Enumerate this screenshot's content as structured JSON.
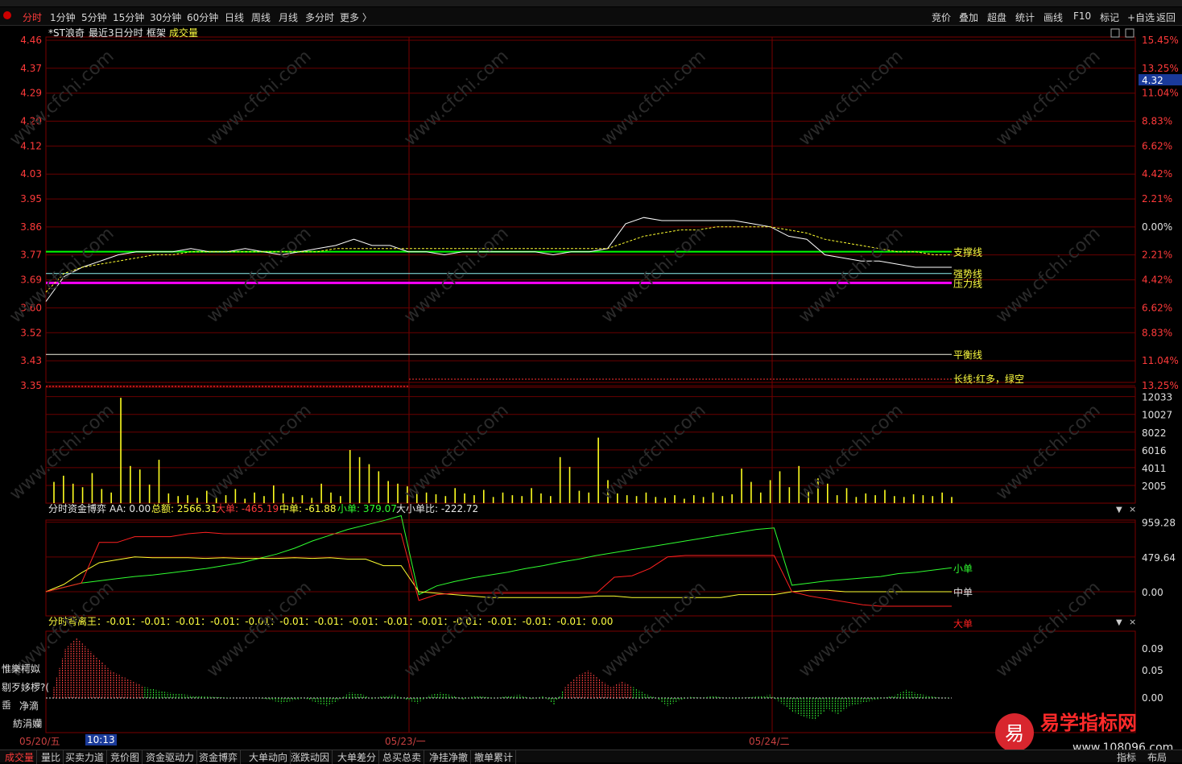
{
  "toolbar": {
    "left": [
      "分时",
      "1分钟",
      "5分钟",
      "15分钟",
      "30分钟",
      "60分钟",
      "日线",
      "周线",
      "月线",
      "多分时",
      "更多 〉"
    ],
    "right": [
      "竞价",
      "叠加",
      "超盘",
      "统计",
      "画线",
      "F10",
      "标记",
      "+自选",
      "返回"
    ]
  },
  "header": {
    "stock": "*ST浪奇",
    "mode": "最近3日分时",
    "frame": "框架",
    "indicator": "成交量"
  },
  "price_panel": {
    "left_ticks": [
      "4.46",
      "4.37",
      "4.29",
      "4.20",
      "4.12",
      "4.03",
      "3.95",
      "3.86",
      "3.77",
      "3.69",
      "3.60",
      "3.52",
      "3.43",
      "3.35"
    ],
    "right_ticks": [
      "15.45%",
      "13.25%",
      "11.04%",
      "8.83%",
      "6.62%",
      "4.42%",
      "2.21%",
      "0.00%",
      "2.21%",
      "4.42%",
      "6.62%",
      "8.83%",
      "11.04%",
      "13.25%"
    ],
    "current_price": "4.32",
    "line_labels": {
      "support": "支撑线",
      "strong": "强势线",
      "pressure": "压力线",
      "balance": "平衡线",
      "long": "长线:红多，绿空"
    }
  },
  "volume_panel": {
    "right_ticks": [
      "12033",
      "10027",
      "8022",
      "6016",
      "4011",
      "2005"
    ]
  },
  "fund_panel": {
    "title": "分时资金博弈",
    "aa": "AA: 0.00",
    "total": "总额: 2566.31",
    "large": "大单: -465.19",
    "mid": "中单: -61.88",
    "small": "小单: 379.07",
    "ratio": "大小单比: -222.72",
    "right_ticks": [
      "959.28",
      "479.64",
      "0.00"
    ],
    "line_labels": {
      "small": "小单",
      "mid": "中单",
      "large": "大单"
    }
  },
  "divergence_panel": {
    "title": "分时背离王：-0.01：-0.01：-0.01：-0.01：-0.01：-0.01：-0.01：-0.01：-0.01：-0.01：-0.01：-0.01：-0.01：-0.01：0.00",
    "right_ticks": [
      "0.09",
      "0.05",
      "0.00"
    ]
  },
  "side_labels": [
    "惟樂樗姒",
    "剔歹姼椤?(",
    "𡸁",
    "净滴",
    "紡涓孏"
  ],
  "dates": [
    "05/20/五",
    "10:13",
    "05/23/一",
    "05/24/二"
  ],
  "bottom_tabs": [
    "成交量",
    "量比",
    "买卖力道",
    "竞价图",
    "资金驱动力",
    "资金博弈",
    "大单动向",
    "涨跌动因",
    "大单差分",
    "总买总卖",
    "净挂净撤",
    "撤单累计"
  ],
  "bottom_right": [
    "指标",
    "布局"
  ],
  "brand": {
    "text": "易学指标网",
    "url": "www.108096.com"
  },
  "watermark": "www.cfchi.com",
  "colors": {
    "up": "#ff3232",
    "down": "#00e000",
    "grid": "#6a0000",
    "yellow": "#ffff00",
    "magenta": "#ff00ff",
    "cyan": "#8ef0f0",
    "green_line": "#00ff00"
  },
  "chart_data": {
    "type": "line",
    "title": "",
    "x_days": [
      "05/20/五",
      "05/23/一",
      "05/24/二"
    ],
    "price": {
      "ylim": [
        3.35,
        4.46
      ],
      "base": 3.86,
      "support": 3.77,
      "strong": 3.7,
      "pressure": 3.67,
      "balance": 3.44,
      "series": [
        {
          "name": "price",
          "values": [
            3.61,
            3.69,
            3.72,
            3.74,
            3.76,
            3.77,
            3.77,
            3.77,
            3.78,
            3.77,
            3.77,
            3.78,
            3.77,
            3.76,
            3.77,
            3.78,
            3.79,
            3.81,
            3.79,
            3.79,
            3.77,
            3.77,
            3.76,
            3.77,
            3.77,
            3.77,
            3.77,
            3.77,
            3.76,
            3.77,
            3.77,
            3.78,
            3.86,
            3.88,
            3.87,
            3.87,
            3.87,
            3.87,
            3.87,
            3.86,
            3.85,
            3.82,
            3.81,
            3.76,
            3.75,
            3.74,
            3.74,
            3.73,
            3.72,
            3.72,
            3.72
          ]
        },
        {
          "name": "avg",
          "values": [
            3.64,
            3.7,
            3.72,
            3.73,
            3.74,
            3.75,
            3.76,
            3.76,
            3.77,
            3.77,
            3.77,
            3.77,
            3.77,
            3.77,
            3.77,
            3.77,
            3.78,
            3.78,
            3.78,
            3.78,
            3.78,
            3.78,
            3.78,
            3.78,
            3.78,
            3.78,
            3.78,
            3.78,
            3.78,
            3.78,
            3.78,
            3.78,
            3.8,
            3.82,
            3.83,
            3.84,
            3.84,
            3.85,
            3.85,
            3.85,
            3.85,
            3.84,
            3.83,
            3.81,
            3.8,
            3.79,
            3.78,
            3.77,
            3.77,
            3.76,
            3.76
          ]
        }
      ]
    },
    "volume": {
      "ylim": [
        0,
        14000
      ],
      "values": [
        2400,
        3100,
        2200,
        1800,
        3400,
        1600,
        1200,
        11900,
        4200,
        3800,
        2100,
        4900,
        1100,
        800,
        900,
        600,
        1400,
        700,
        900,
        1600,
        500,
        1200,
        800,
        2000,
        1100,
        700,
        900,
        600,
        2200,
        1200,
        800,
        6000,
        5200,
        4400,
        3600,
        2500,
        2200,
        1900,
        1400,
        1200,
        1000,
        800,
        1700,
        1100,
        900,
        1500,
        700,
        1200,
        900,
        800,
        1700,
        1100,
        800,
        5200,
        4100,
        1400,
        1200,
        7400,
        2600,
        1100,
        900,
        800,
        1200,
        700,
        600,
        900,
        500,
        900,
        700,
        1200,
        800,
        1000,
        3900,
        2400,
        1200,
        2600,
        3600,
        1800,
        4200,
        1300,
        2800,
        2200,
        900,
        1700,
        700,
        1100,
        900,
        1500,
        800,
        700,
        1000,
        900,
        800,
        1200,
        700
      ]
    },
    "fund": {
      "ylim": [
        -200,
        1100
      ],
      "series": [
        {
          "name": "小单",
          "values": [
            0,
            60,
            120,
            150,
            180,
            210,
            230,
            260,
            290,
            320,
            360,
            400,
            460,
            520,
            600,
            700,
            780,
            860,
            920,
            980,
            1050,
            -40,
            80,
            140,
            190,
            230,
            270,
            320,
            360,
            410,
            450,
            500,
            540,
            580,
            620,
            660,
            700,
            740,
            780,
            820,
            860,
            880,
            90,
            120,
            150,
            170,
            190,
            210,
            250,
            270,
            300,
            330
          ]
        },
        {
          "name": "中单",
          "values": [
            0,
            100,
            260,
            400,
            440,
            480,
            470,
            470,
            470,
            460,
            470,
            460,
            460,
            460,
            470,
            460,
            470,
            450,
            450,
            360,
            360,
            0,
            -20,
            -40,
            -60,
            -80,
            -80,
            -80,
            -80,
            -80,
            -80,
            -60,
            -60,
            -80,
            -80,
            -80,
            -80,
            -80,
            -80,
            -40,
            -40,
            -40,
            0,
            20,
            20,
            0,
            0,
            0,
            0,
            0,
            0,
            0
          ]
        },
        {
          "name": "大单",
          "values": [
            0,
            60,
            120,
            680,
            680,
            760,
            760,
            760,
            800,
            820,
            800,
            800,
            800,
            800,
            800,
            800,
            800,
            800,
            800,
            800,
            800,
            -120,
            -40,
            -20,
            -20,
            -20,
            -20,
            -20,
            -20,
            -20,
            -20,
            -20,
            200,
            220,
            320,
            480,
            500,
            500,
            500,
            500,
            500,
            500,
            0,
            -60,
            -100,
            -140,
            -180,
            -200,
            -200,
            -200,
            -200,
            -200
          ]
        }
      ]
    },
    "divergence": {
      "ylim": [
        -0.05,
        0.12
      ],
      "values": [
        0.02,
        0.09,
        0.11,
        0.09,
        0.07,
        0.05,
        0.04,
        0.03,
        0.02,
        0.015,
        0.01,
        0.008,
        0.005,
        0.003,
        0.002,
        0.001,
        0.0,
        0.0,
        0.0,
        -0.003,
        -0.01,
        -0.005,
        0.0,
        -0.008,
        -0.015,
        -0.005,
        0.01,
        0.008,
        -0.002,
        0.004,
        0.006,
        -0.003,
        -0.01,
        0.005,
        0.01,
        0.005,
        -0.003,
        0.004,
        0.002,
        0.0,
        0.004,
        0.006,
        -0.002,
        0.003,
        -0.012,
        0.02,
        0.04,
        0.05,
        0.035,
        0.02,
        0.03,
        0.02,
        0.008,
        0.0,
        -0.015,
        -0.005,
        0.002,
        0.0,
        0.004,
        0.0,
        -0.002,
        0.001,
        0.003,
        0.006,
        -0.01,
        -0.025,
        -0.035,
        -0.04,
        -0.02,
        -0.03,
        -0.015,
        -0.01,
        -0.005,
        0.0,
        0.005,
        0.015,
        0.008,
        0.004,
        0.0,
        0.001
      ]
    }
  }
}
